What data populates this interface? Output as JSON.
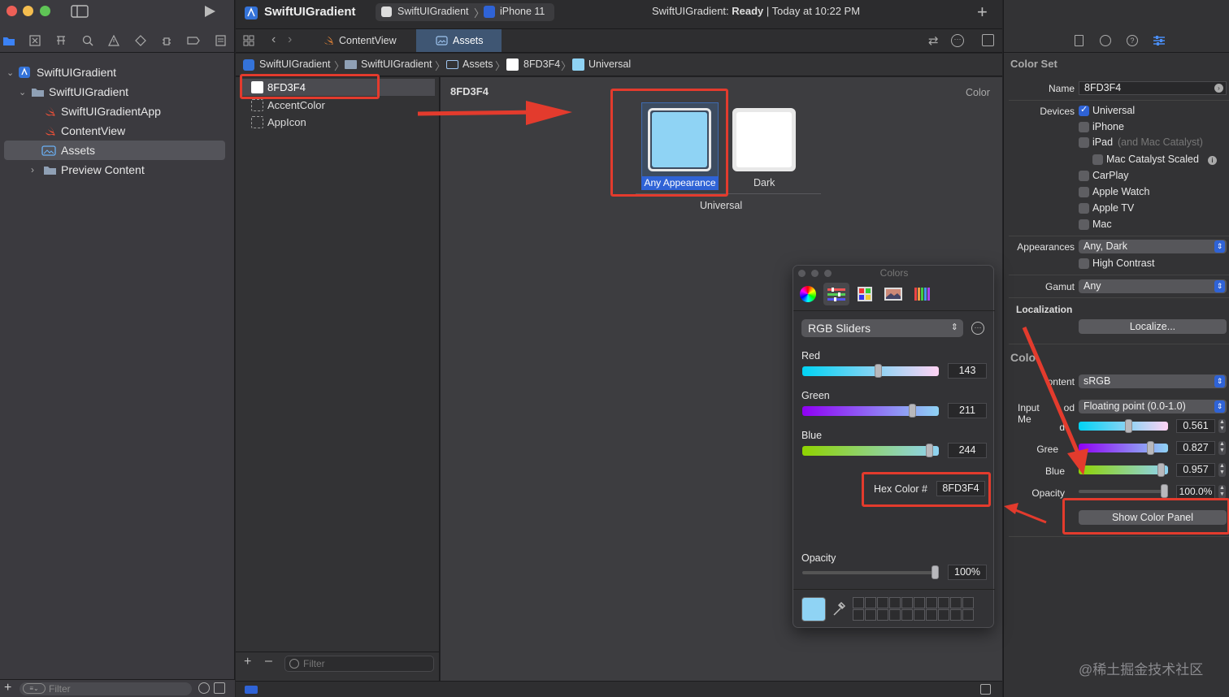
{
  "toolbar": {
    "project_title": "SwiftUIGradient",
    "scheme": "SwiftUIGradient",
    "device": "iPhone 11",
    "status_prefix": "SwiftUIGradient: ",
    "status_state": "Ready",
    "status_suffix": " | Today at 10:22 PM"
  },
  "navigator": {
    "items": [
      {
        "label": "SwiftUIGradient"
      },
      {
        "label": "SwiftUIGradient"
      },
      {
        "label": "SwiftUIGradientApp"
      },
      {
        "label": "ContentView"
      },
      {
        "label": "Assets"
      },
      {
        "label": "Preview Content"
      }
    ],
    "filter_placeholder": "Filter"
  },
  "tabs": [
    {
      "label": "ContentView"
    },
    {
      "label": "Assets"
    }
  ],
  "breadcrumb": [
    {
      "label": "SwiftUIGradient"
    },
    {
      "label": "SwiftUIGradient"
    },
    {
      "label": "Assets"
    },
    {
      "label": "8FD3F4"
    },
    {
      "label": "Universal"
    }
  ],
  "asset_list": {
    "items": [
      {
        "label": "8FD3F4"
      },
      {
        "label": "AccentColor"
      },
      {
        "label": "AppIcon"
      }
    ],
    "filter_placeholder": "Filter"
  },
  "canvas": {
    "title": "8FD3F4",
    "type_label": "Color",
    "wells": [
      {
        "label": "Any Appearance",
        "color": "#8fd3f4"
      },
      {
        "label": "Dark",
        "color": "#ffffff"
      }
    ],
    "group_label": "Universal"
  },
  "inspector": {
    "section_title": "Color Set",
    "name_label": "Name",
    "name_value": "8FD3F4",
    "devices_label": "Devices",
    "devices": [
      {
        "label": "Universal",
        "checked": true
      },
      {
        "label": "iPhone",
        "checked": false
      },
      {
        "label": "iPad",
        "checked": false,
        "suffix": "(and Mac Catalyst)"
      },
      {
        "label": "Mac Catalyst Scaled",
        "checked": false
      },
      {
        "label": "CarPlay",
        "checked": false
      },
      {
        "label": "Apple Watch",
        "checked": false
      },
      {
        "label": "Apple TV",
        "checked": false
      },
      {
        "label": "Mac",
        "checked": false
      }
    ],
    "appearances_label": "Appearances",
    "appearances_value": "Any, Dark",
    "high_contrast_label": "High Contrast",
    "gamut_label": "Gamut",
    "gamut_value": "Any",
    "localization_title": "Localization",
    "localize_button": "Localize...",
    "color_title": "Colo",
    "content_label": "ontent",
    "content_value": "sRGB",
    "input_method_label": "Input Me",
    "input_method_label2": "od",
    "input_method_value": "Floating point (0.0-1.0)",
    "red_label": "d",
    "red_value": "0.561",
    "red_fraction": 0.561,
    "green_label": "Gree",
    "green_value": "0.827",
    "green_fraction": 0.827,
    "blue_label": "Blue",
    "blue_value": "0.957",
    "blue_fraction": 0.957,
    "opacity_label": "Opacity",
    "opacity_value": "100.0%",
    "opacity_fraction": 1.0,
    "show_panel_button": "Show Color Panel"
  },
  "color_panel": {
    "title": "Colors",
    "mode": "RGB Sliders",
    "red_label": "Red",
    "red_value": "143",
    "red_fraction": 0.561,
    "green_label": "Green",
    "green_value": "211",
    "green_fraction": 0.827,
    "blue_label": "Blue",
    "blue_value": "244",
    "blue_fraction": 0.957,
    "hex_label": "Hex Color #",
    "hex_value": "8FD3F4",
    "opacity_label": "Opacity",
    "opacity_value": "100%",
    "opacity_fraction": 1.0,
    "current_color": "#8fd3f4"
  },
  "watermark": "@稀土掘金技术社区",
  "colors": {
    "accent": "#2f63d6",
    "annotation_red": "#e33b2d",
    "selected_color": "#8fd3f4"
  }
}
